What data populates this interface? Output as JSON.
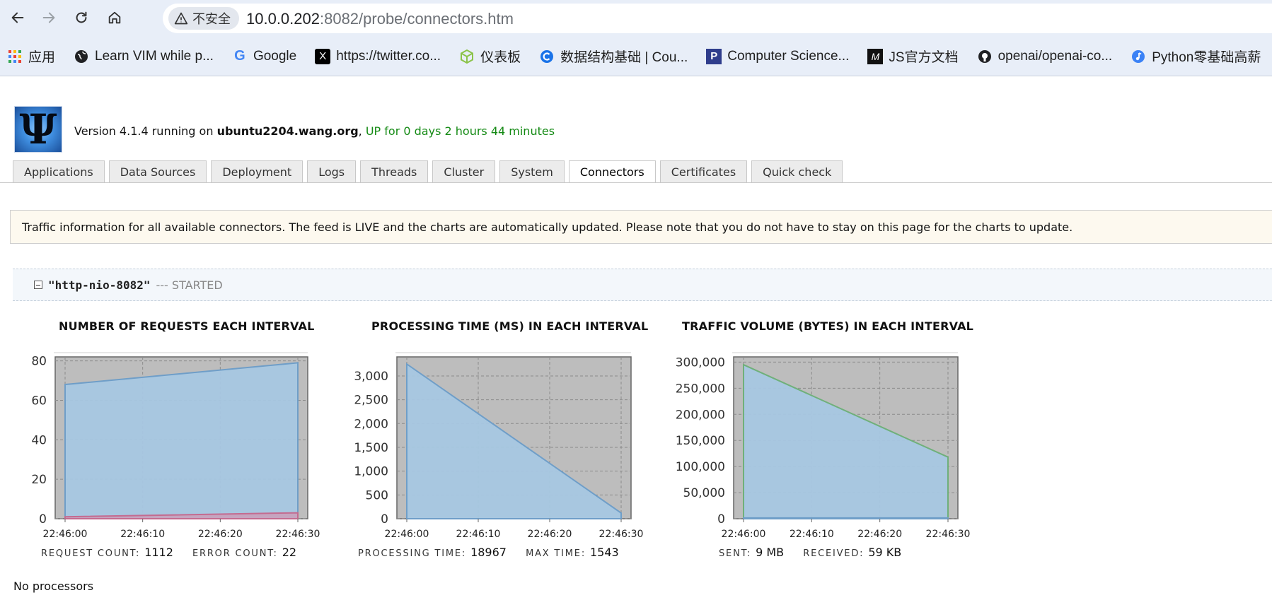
{
  "browser": {
    "security_label": "不安全",
    "url_host": "10.0.0.202",
    "url_rest": ":8082/probe/connectors.htm",
    "bookmarks": [
      {
        "label": "应用",
        "icon": "apps-grid-icon"
      },
      {
        "label": "Learn VIM while p...",
        "icon": "globe-icon"
      },
      {
        "label": "Google",
        "icon": "google-icon"
      },
      {
        "label": "https://twitter.co...",
        "icon": "x-icon"
      },
      {
        "label": "仪表板",
        "icon": "cube-icon"
      },
      {
        "label": "数据结构基础 | Cou...",
        "icon": "coursera-icon"
      },
      {
        "label": "Computer Science...",
        "icon": "p-icon"
      },
      {
        "label": "JS官方文档",
        "icon": "m-icon"
      },
      {
        "label": "openai/openai-co...",
        "icon": "github-icon"
      },
      {
        "label": "Python零基础高薪",
        "icon": "music-icon"
      }
    ]
  },
  "probe": {
    "version_prefix": "Version 4.1.4 running on ",
    "host": "ubuntu2204.wang.org",
    "uptime": "UP for 0 days 2 hours 44 minutes",
    "tabs": [
      "Applications",
      "Data Sources",
      "Deployment",
      "Logs",
      "Threads",
      "Cluster",
      "System",
      "Connectors",
      "Certificates",
      "Quick check"
    ],
    "active_tab": "Connectors",
    "info": "Traffic information for all available connectors. The feed is LIVE and the charts are automatically updated. Please note that you do not have to stay on this page for the charts to update.",
    "connector_name": "\"http-nio-8082\"",
    "connector_status": "--- STARTED",
    "stats": {
      "request_count_label": "REQUEST COUNT:",
      "request_count": "1112",
      "error_count_label": "ERROR COUNT:",
      "error_count": "22",
      "processing_time_label": "PROCESSING TIME:",
      "processing_time": "18967",
      "max_time_label": "MAX TIME:",
      "max_time": "1543",
      "sent_label": "SENT:",
      "sent": "9 MB",
      "received_label": "RECEIVED:",
      "received": "59 KB"
    },
    "no_processors": "No processors"
  },
  "chart_data": [
    {
      "type": "area",
      "title": "NUMBER OF REQUESTS EACH INTERVAL",
      "x": [
        "22:46:00",
        "22:46:10",
        "22:46:20",
        "22:46:30"
      ],
      "x_values": [
        0,
        30
      ],
      "yticks": [
        0,
        20,
        40,
        60,
        80
      ],
      "ylabels": [
        "0",
        "20",
        "40",
        "60",
        "80"
      ],
      "ylim": [
        0,
        82
      ],
      "series": [
        {
          "values": [
            68,
            79
          ],
          "fill": "#a7c7e2",
          "stroke": "#6f9ec8"
        },
        {
          "values": [
            1,
            3
          ],
          "fill": "#c7a2bd",
          "stroke": "#c46b90"
        }
      ],
      "grid": true
    },
    {
      "type": "area",
      "title": "PROCESSING TIME (MS) IN EACH INTERVAL",
      "x": [
        "22:46:00",
        "22:46:10",
        "22:46:20",
        "22:46:30"
      ],
      "x_values": [
        0,
        30
      ],
      "yticks": [
        0,
        500,
        1000,
        1500,
        2000,
        2500,
        3000
      ],
      "ylabels": [
        "0",
        "500",
        "1,000",
        "1,500",
        "2,000",
        "2,500",
        "3,000"
      ],
      "ylim": [
        0,
        3400
      ],
      "series": [
        {
          "values": [
            3250,
            120
          ],
          "fill": "#a7c7e2",
          "stroke": "#6f9ec8"
        }
      ],
      "grid": true
    },
    {
      "type": "area",
      "title": "TRAFFIC VOLUME (BYTES) IN EACH INTERVAL",
      "x": [
        "22:46:00",
        "22:46:10",
        "22:46:20",
        "22:46:30"
      ],
      "x_values": [
        0,
        30
      ],
      "yticks": [
        0,
        50000,
        100000,
        150000,
        200000,
        250000,
        300000
      ],
      "ylabels": [
        "0",
        "50,000",
        "100,000",
        "150,000",
        "200,000",
        "250,000",
        "300,000"
      ],
      "ylim": [
        0,
        310000
      ],
      "series": [
        {
          "values": [
            295000,
            118000
          ],
          "fill": "#a7c7e2",
          "stroke": "#6fb07a"
        },
        {
          "values": [
            1500,
            1500
          ],
          "fill": "#a7c7e2",
          "stroke": "#6f9ec8"
        }
      ],
      "grid": true
    }
  ]
}
